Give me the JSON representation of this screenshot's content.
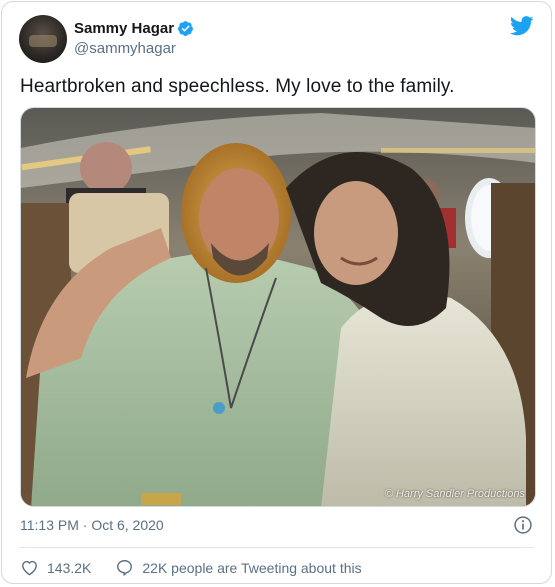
{
  "tweet": {
    "author": {
      "name": "Sammy Hagar",
      "handle": "@sammyhagar",
      "verified": true
    },
    "text": "Heartbroken and speechless. My love to the family.",
    "media": {
      "credit": "© Harry Sandler Productions"
    },
    "timestamp": "11:13 PM · Oct 6, 2020",
    "likes": "143.2K",
    "conversation": "22K people are Tweeting about this"
  },
  "colors": {
    "brand_blue": "#1da1f2",
    "text_primary": "#14171a",
    "text_secondary": "#5b7083",
    "border": "#cfd9de"
  },
  "icons": {
    "logo": "twitter-bird-icon",
    "verified": "verified-badge-icon",
    "info": "info-icon",
    "like": "heart-icon",
    "reply": "speech-bubble-icon"
  }
}
